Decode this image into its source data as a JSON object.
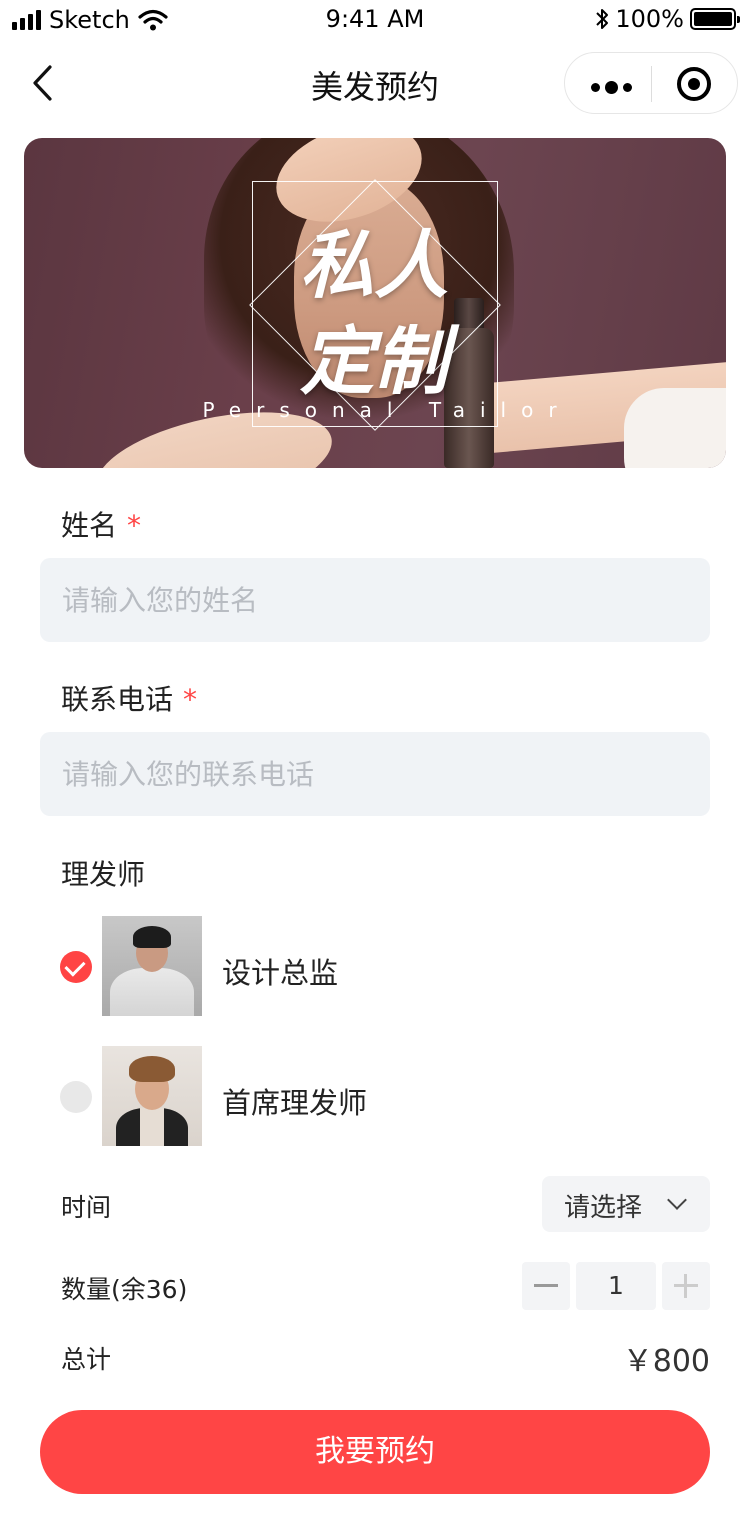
{
  "status_bar": {
    "carrier": "Sketch",
    "time": "9:41 AM",
    "battery": "100%"
  },
  "nav": {
    "title": "美发预约"
  },
  "banner": {
    "title_line1": "私人",
    "title_line2": "定制",
    "subtitle": "Personal Tailor"
  },
  "form": {
    "name": {
      "label": "姓名",
      "required_mark": "*",
      "placeholder": "请输入您的姓名",
      "value": ""
    },
    "phone": {
      "label": "联系电话",
      "required_mark": "*",
      "placeholder": "请输入您的联系电话",
      "value": ""
    },
    "barber": {
      "label": "理发师",
      "options": [
        {
          "name": "设计总监",
          "selected": true
        },
        {
          "name": "首席理发师",
          "selected": false
        }
      ]
    },
    "time": {
      "label": "时间",
      "value": "请选择"
    },
    "quantity": {
      "label": "数量(余36)",
      "value": "1"
    },
    "total": {
      "label": "总计",
      "value": "￥800"
    },
    "submit_label": "我要预约"
  },
  "colors": {
    "accent": "#ff4545",
    "field_bg": "#f0f3f6"
  }
}
